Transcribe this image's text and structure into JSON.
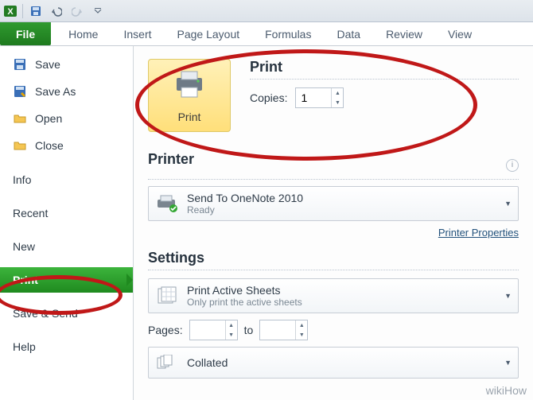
{
  "qat": {
    "app": "Excel"
  },
  "ribbon": {
    "tabs": {
      "file": "File",
      "home": "Home",
      "insert": "Insert",
      "pagelayout": "Page Layout",
      "formulas": "Formulas",
      "data": "Data",
      "review": "Review",
      "view": "View"
    }
  },
  "sidebar": {
    "save": "Save",
    "saveas": "Save As",
    "open": "Open",
    "close": "Close",
    "info": "Info",
    "recent": "Recent",
    "new": "New",
    "print": "Print",
    "savesend": "Save & Send",
    "help": "Help"
  },
  "print": {
    "button_label": "Print",
    "heading": "Print",
    "copies_label": "Copies:",
    "copies_value": "1"
  },
  "printer": {
    "heading": "Printer",
    "selected_name": "Send To OneNote 2010",
    "selected_status": "Ready",
    "properties_link": "Printer Properties"
  },
  "settings": {
    "heading": "Settings",
    "scope_title": "Print Active Sheets",
    "scope_sub": "Only print the active sheets",
    "pages_label": "Pages:",
    "pages_to": "to",
    "collated": "Collated"
  },
  "watermark": "wikiHow"
}
